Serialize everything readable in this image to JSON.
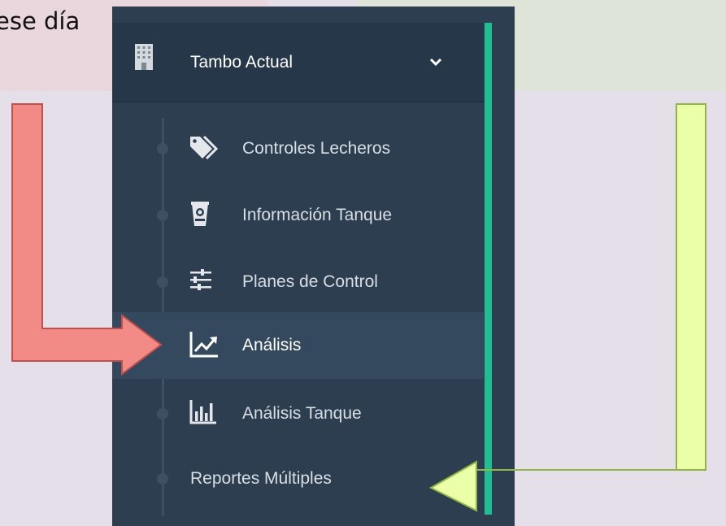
{
  "caption_text": "ese día",
  "sidebar": {
    "section_title": "Tambo Actual",
    "section_icon": "building-icon",
    "expand_icon": "chevron-down-icon",
    "items": [
      {
        "label": "Controles Lecheros",
        "icon": "tags-icon",
        "active": false
      },
      {
        "label": "Información Tanque",
        "icon": "tank-icon",
        "active": false
      },
      {
        "label": "Planes de Control",
        "icon": "sliders-icon",
        "active": false
      },
      {
        "label": "Análisis",
        "icon": "line-chart-icon",
        "active": true
      },
      {
        "label": "Análisis Tanque",
        "icon": "bar-chart-icon",
        "active": false
      },
      {
        "label": "Reportes Múltiples",
        "icon": "",
        "active": false
      }
    ]
  },
  "colors": {
    "sidebar_bg": "#2c3e50",
    "accent": "#1fbf93",
    "active_item_bg": "#35495e",
    "arrow_red": "#f28b85",
    "arrow_green": "#eaffa8"
  }
}
